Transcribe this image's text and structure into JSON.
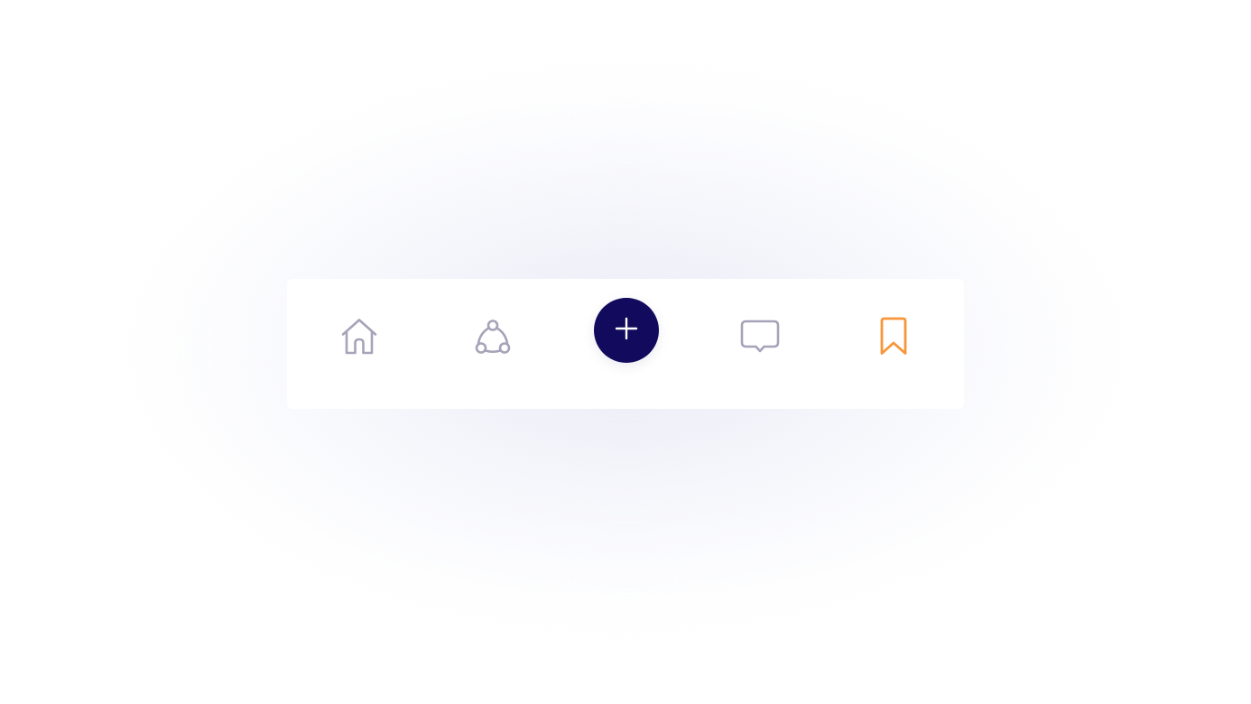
{
  "background": "#ffffff",
  "navbar": {
    "items": [
      {
        "id": "home",
        "icon": "home-icon",
        "active": false,
        "color": "#a7a3b8"
      },
      {
        "id": "connect",
        "icon": "network-icon",
        "active": false,
        "color": "#a7a3b8"
      },
      {
        "id": "add",
        "icon": "plus-icon",
        "active": false,
        "color": "#ffffff",
        "background": "#120a5c"
      },
      {
        "id": "chat",
        "icon": "chat-bubble-icon",
        "active": false,
        "color": "#a7a3b8"
      },
      {
        "id": "bookmark",
        "icon": "bookmark-icon",
        "active": true,
        "color": "#f7963a"
      }
    ]
  }
}
